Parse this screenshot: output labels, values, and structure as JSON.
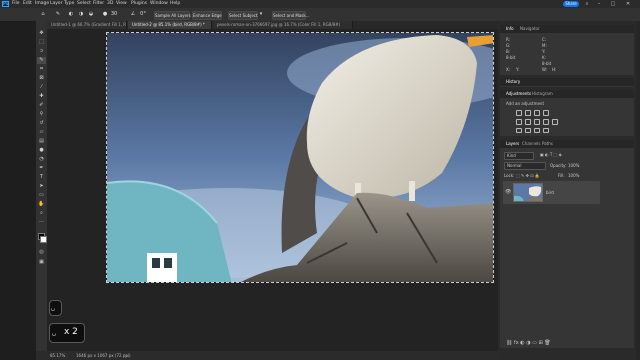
{
  "menubar": {
    "app_logo": "Ps",
    "items": [
      "File",
      "Edit",
      "Image",
      "Layer",
      "Type",
      "Select",
      "Filter",
      "3D",
      "View",
      "Plugins",
      "Window",
      "Help"
    ],
    "share_label": "Share"
  },
  "options": {
    "brush_size": "30",
    "sample_all_layers": "Sample All Layers",
    "enhance_edge": "Enhance Edge",
    "select_subject": "Select Subject",
    "select_and_mask": "Select and Mask..."
  },
  "tabs": [
    {
      "label": "Untitled-1 @ 66.7% (Gradient Fill 1, RGB/8#)",
      "active": false
    },
    {
      "label": "Untitled-2 @ 85.1% (bird, RGB/8#) *",
      "active": true
    },
    {
      "label": "pexels-roman-on-3766697.jpg @ 16.7% (Color Fill 1, RGB/8#)",
      "active": false
    }
  ],
  "keystrokes": {
    "first": "␣",
    "second": "␣",
    "second_count": "x 2"
  },
  "status": {
    "zoom": "85.17%",
    "doc_size": "1646 px x 1067 px (72 ppi)"
  },
  "info_panel": {
    "tabs": [
      "Info",
      "Navigator"
    ],
    "readouts": [
      "R:",
      "G:",
      "B:",
      "8-bit",
      "C:",
      "M:",
      "Y:",
      "K:",
      "8-bit",
      "X:",
      "Y:",
      "W:",
      "H:"
    ]
  },
  "history_panel": {
    "tabs": [
      "History"
    ]
  },
  "adjustments_panel": {
    "tabs": [
      "Adjustments",
      "Histogram"
    ],
    "add_label": "Add an adjustment"
  },
  "layers_panel": {
    "tabs": [
      "Layers",
      "Channels",
      "Paths"
    ],
    "kind_filter": "Kind",
    "blend_mode": "Normal",
    "opacity_label": "Opacity:",
    "opacity_value": "100%",
    "lock_label": "Lock:",
    "fill_label": "Fill:",
    "fill_value": "100%",
    "layer_name": "bird"
  },
  "colors": {
    "accent": "#1473e6",
    "panel_bg": "#353535",
    "app_bg": "#1e1e1e"
  }
}
